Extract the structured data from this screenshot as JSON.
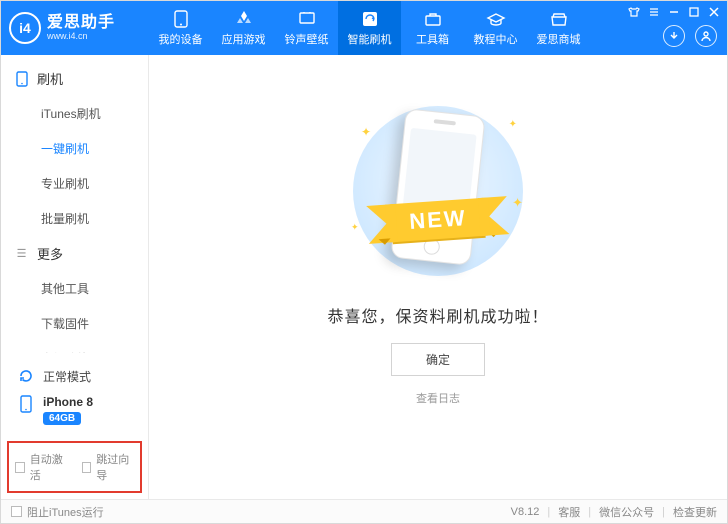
{
  "brand": {
    "name": "爱思助手",
    "site": "www.i4.cn",
    "badge": "i4"
  },
  "nav": {
    "items": [
      {
        "label": "我的设备"
      },
      {
        "label": "应用游戏"
      },
      {
        "label": "铃声壁纸"
      },
      {
        "label": "智能刷机"
      },
      {
        "label": "工具箱"
      },
      {
        "label": "教程中心"
      },
      {
        "label": "爱思商城"
      }
    ],
    "active_index": 3
  },
  "sidebar": {
    "group1": {
      "title": "刷机",
      "items": [
        "iTunes刷机",
        "一键刷机",
        "专业刷机",
        "批量刷机"
      ],
      "active_index": 1
    },
    "group2": {
      "title": "更多",
      "items": [
        "其他工具",
        "下载固件",
        "高级功能"
      ]
    },
    "mode": {
      "label": "正常模式"
    },
    "device": {
      "name": "iPhone 8",
      "storage": "64GB"
    },
    "checkboxes": {
      "auto_activate": "自动激活",
      "skip_guide": "跳过向导"
    }
  },
  "main": {
    "ribbon": "NEW",
    "success": "恭喜您，保资料刷机成功啦！",
    "ok": "确定",
    "log": "查看日志"
  },
  "footer": {
    "block_itunes": "阻止iTunes运行",
    "version": "V8.12",
    "support": "客服",
    "wechat": "微信公众号",
    "update": "检查更新"
  }
}
